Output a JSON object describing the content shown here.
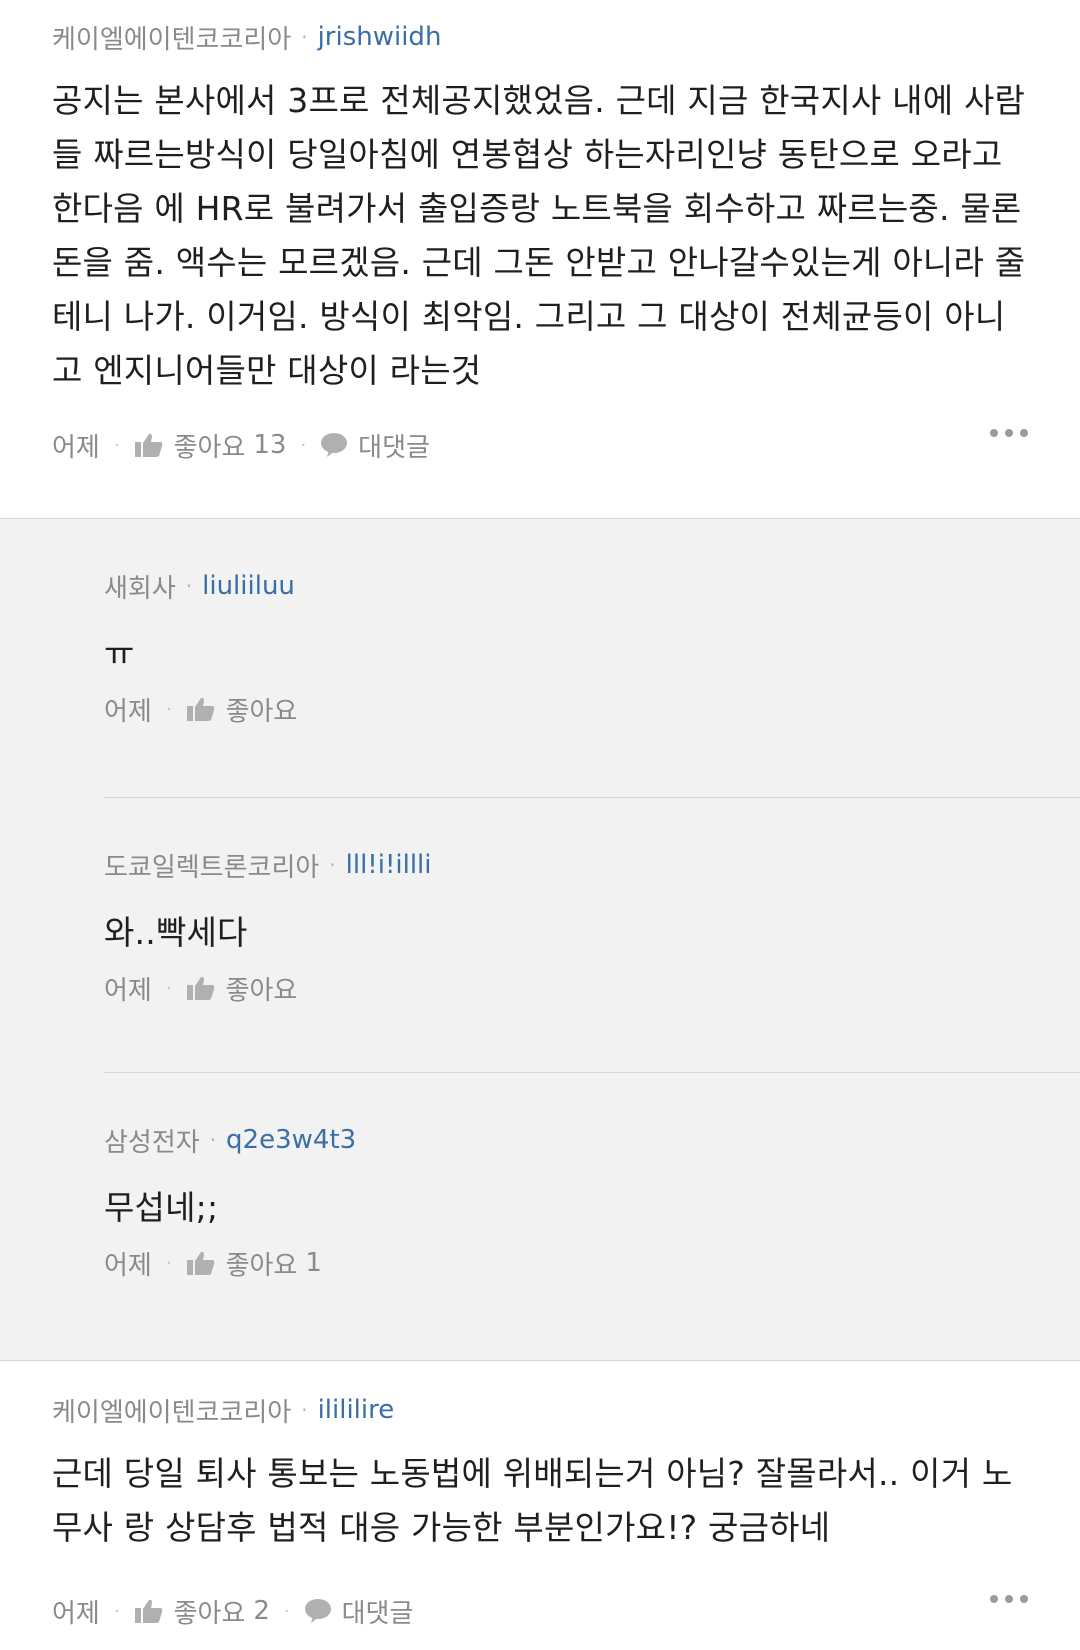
{
  "comments": [
    {
      "company": "케이엘에이텐코코리아",
      "nickname": "jrishwiidh",
      "body": "공지는 본사에서 3프로 전체공지했었음. 근데 지금 한국지사 내에 사람들 짜르는방식이 당일아침에 연봉협상 하는자리인냥 동탄으로 오라고한다음 에 HR로 불려가서 출입증랑 노트북을 회수하고 짜르는중. 물론 돈을 줌. 액수는 모르겠음. 근데 그돈 안받고 안나갈수있는게 아니라 줄테니 나가. 이거임. 방식이 최악임. 그리고 그 대상이 전체균등이 아니고 엔지니어들만 대상이 라는것",
      "time": "어제",
      "like_label": "좋아요",
      "like_count": "13",
      "reply_label": "대댓글"
    },
    {
      "company": "케이엘에이텐코코리아",
      "nickname": "ilililire",
      "body": "근데 당일 퇴사 통보는 노동법에 위배되는거 아님? 잘몰라서.. 이거 노무사 랑 상담후 법적 대응 가능한 부분인가요!? 궁금하네",
      "time": "어제",
      "like_label": "좋아요",
      "like_count": "2",
      "reply_label": "대댓글"
    }
  ],
  "replies": [
    {
      "company": "새회사",
      "nickname": "liuliiluu",
      "body": "ㅠ",
      "time": "어제",
      "like_label": "좋아요",
      "like_count": ""
    },
    {
      "company": "도쿄일렉트론코리아",
      "nickname": "lll!i!illli",
      "body": "와..빡세다",
      "time": "어제",
      "like_label": "좋아요",
      "like_count": ""
    },
    {
      "company": "삼성전자",
      "nickname": "q2e3w4t3",
      "body": "무섭네;;",
      "time": "어제",
      "like_label": "좋아요",
      "like_count": "1"
    }
  ],
  "separator": "·",
  "icons": {
    "like": "thumbs-up-icon",
    "reply": "speech-bubble-icon",
    "more": "more-dots-icon"
  },
  "colors": {
    "nickname": "#3a6ea5",
    "meta": "#8a8a8a",
    "reply_bg": "#f2f2f2"
  }
}
